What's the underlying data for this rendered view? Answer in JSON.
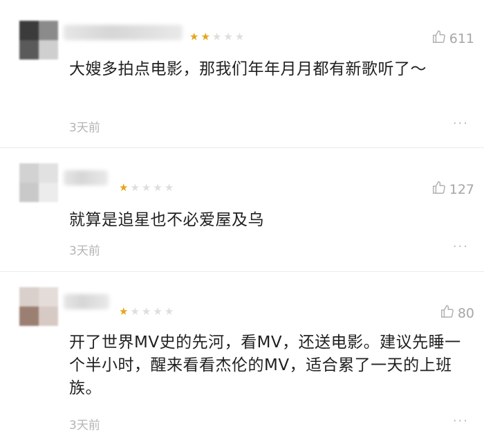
{
  "comments": [
    {
      "rating": 2,
      "likes": "611",
      "text": "大嫂多拍点电影，那我们年年月月都有新歌听了～",
      "time": "3天前",
      "more": "···"
    },
    {
      "rating": 1,
      "likes": "127",
      "text": "就算是追星也不必爱屋及乌",
      "time": "3天前",
      "more": "···"
    },
    {
      "rating": 1,
      "likes": "80",
      "text": "开了世界MV史的先河，看MV，还送电影。建议先睡一个半小时，醒来看看杰伦的MV，适合累了一天的上班族。",
      "time": "3天前",
      "more": "···"
    }
  ],
  "icons": {
    "like": "thumbs-up-icon",
    "star": "star-icon",
    "more": "more-dots-icon"
  },
  "colors": {
    "star_on": "#e6a41c",
    "star_off": "#dedede",
    "muted": "#b4b4b4"
  }
}
